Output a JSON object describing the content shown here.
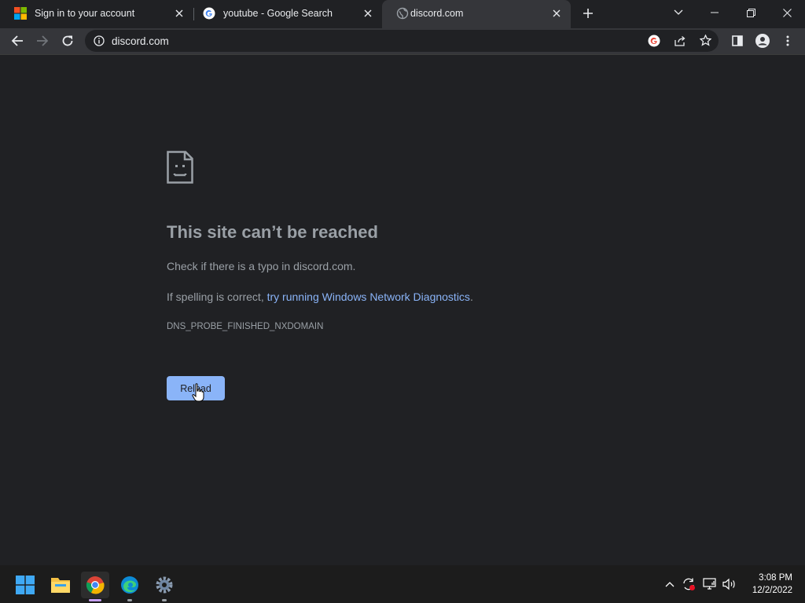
{
  "tabs": [
    {
      "title": "Sign in to your account",
      "favicon": "microsoft-logo",
      "active": false
    },
    {
      "title": "youtube - Google Search",
      "favicon": "google-logo",
      "active": false
    },
    {
      "title": "discord.com",
      "favicon": "globe-icon",
      "active": true
    }
  ],
  "toolbar": {
    "url": "discord.com"
  },
  "error": {
    "title": "This site can’t be reached",
    "line1": "Check if there is a typo in discord.com.",
    "line2_prefix": "If spelling is correct, ",
    "line2_link": "try running Windows Network Diagnostics",
    "line2_suffix": ".",
    "code": "DNS_PROBE_FINISHED_NXDOMAIN",
    "reload_label": "Reload"
  },
  "taskbar": {
    "apps": [
      "start-button",
      "file-explorer",
      "chrome",
      "edge",
      "settings"
    ],
    "time": "3:08 PM",
    "date": "12/2/2022"
  },
  "colors": {
    "link": "#8ab4f8",
    "button": "#8ab4f8",
    "background": "#202124"
  }
}
